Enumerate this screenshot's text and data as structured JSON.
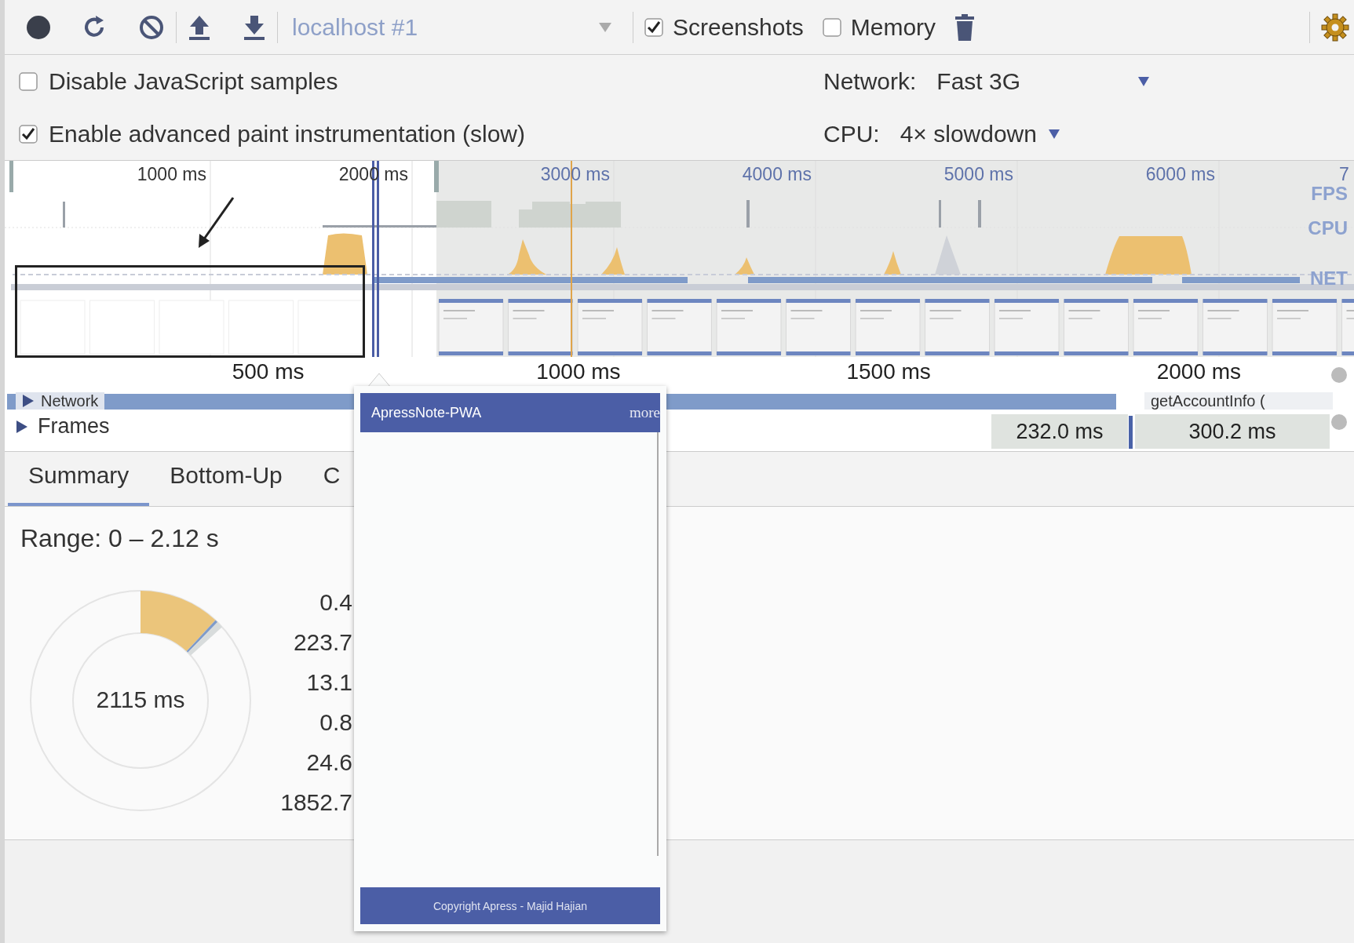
{
  "toolbar": {
    "target": "localhost #1",
    "toggles": [
      {
        "label": "Screenshots",
        "checked": true
      },
      {
        "label": "Memory",
        "checked": false
      }
    ]
  },
  "options": [
    {
      "label": "Disable JavaScript samples",
      "checked": false
    },
    {
      "label": "Enable advanced paint instrumentation (slow)",
      "checked": true
    }
  ],
  "throttling": [
    {
      "label": "Network:",
      "value": "Fast 3G"
    },
    {
      "label": "CPU:",
      "value": "4× slowdown"
    }
  ],
  "overview": {
    "ticks": [
      "1000 ms",
      "2000 ms",
      "3000 ms",
      "4000 ms",
      "5000 ms",
      "6000 ms",
      "7"
    ],
    "tracks": [
      "FPS",
      "CPU",
      "NET"
    ]
  },
  "ruler": [
    "500 ms",
    "1000 ms",
    "1500 ms",
    "2000 ms"
  ],
  "tracks": [
    {
      "label": "Network",
      "expanded": false
    },
    {
      "label": "Frames",
      "expanded": false
    }
  ],
  "network_entry": "getAccountInfo (",
  "frames": [
    "232.0 ms",
    "300.2 ms"
  ],
  "tabs": [
    {
      "label": "Summary",
      "selected": true
    },
    {
      "label": "Bottom-Up",
      "selected": false
    },
    {
      "label": "C",
      "selected": false
    }
  ],
  "summary": {
    "range": "Range: 0 – 2.12 s",
    "total": "2115 ms",
    "values": [
      "0.4",
      "223.7",
      "13.1",
      "0.8",
      "24.6",
      "1852.7"
    ]
  },
  "screenshot_popup": {
    "title": "ApressNote-PWA",
    "menu": "more",
    "footer": "Copyright Apress - Majid Hajian"
  }
}
